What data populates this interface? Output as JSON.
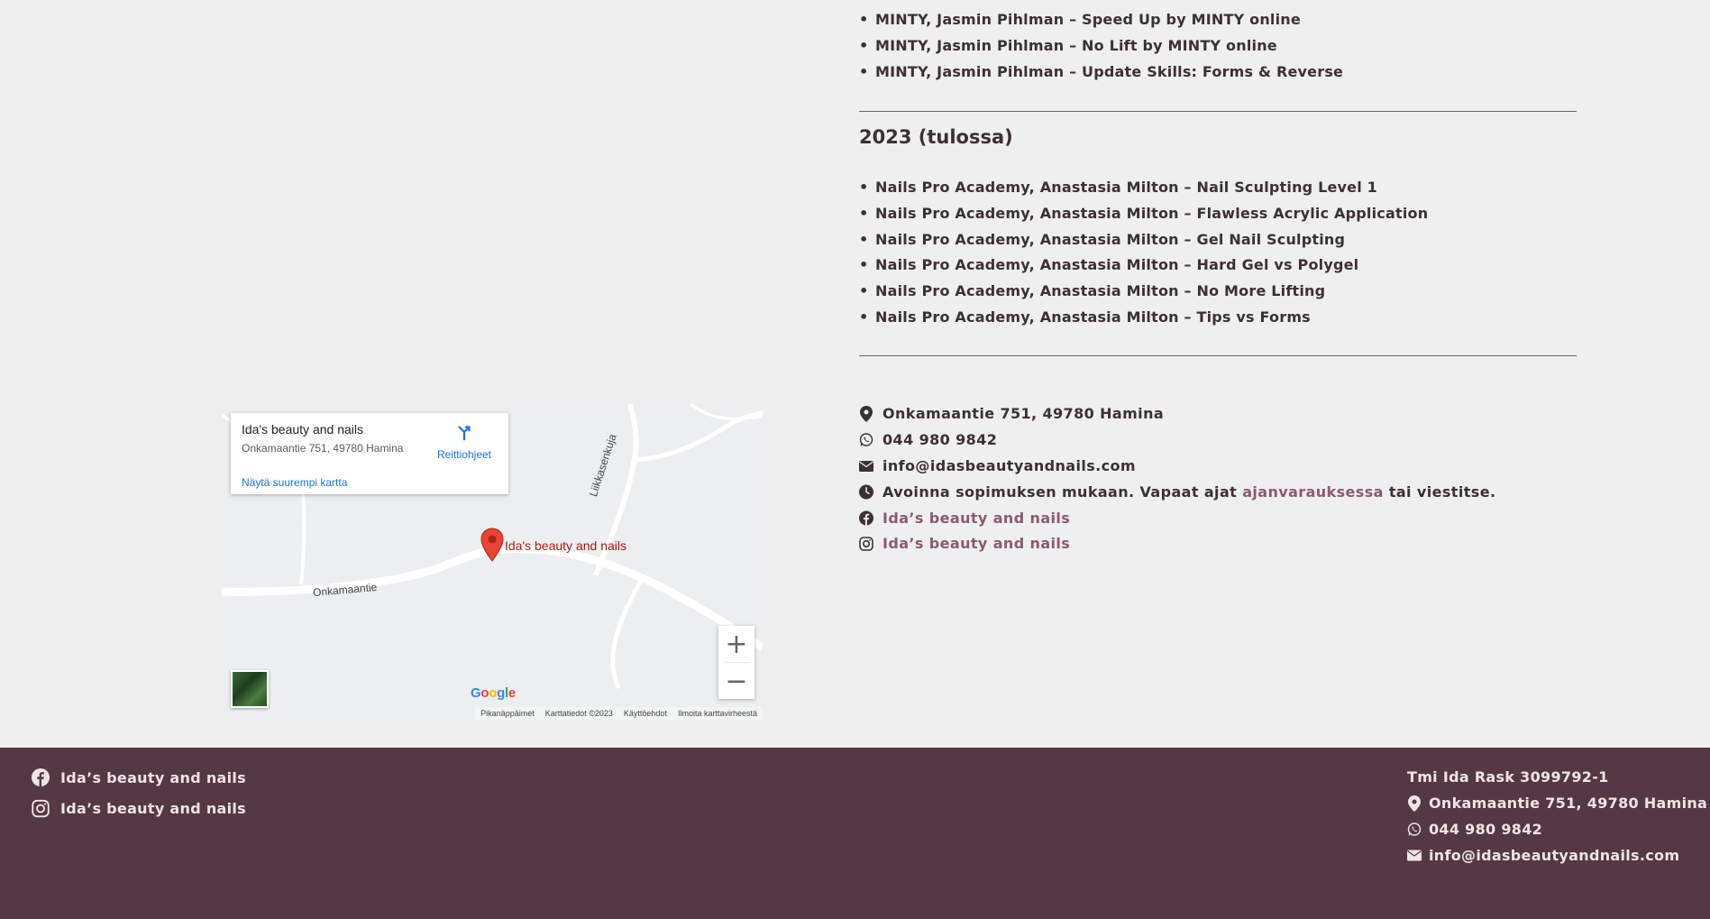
{
  "colors": {
    "page_bg": "#efefef",
    "text": "#3b3035",
    "link": "#8a5a70",
    "divider": "#7a5a66",
    "footer_bg": "#543843",
    "footer_text": "#f1e4e4"
  },
  "courses_2022": [
    "MINTY, Jasmin Pihlman – Speed Up by MINTY online",
    "MINTY, Jasmin Pihlman – No Lift by MINTY online",
    "MINTY, Jasmin Pihlman – Update Skills: Forms & Reverse"
  ],
  "year_2023": {
    "heading": "2023 (tulossa)",
    "courses": [
      "Nails Pro Academy, Anastasia Milton – Nail Sculpting Level 1",
      "Nails Pro Academy, Anastasia Milton – Flawless Acrylic Application",
      "Nails Pro Academy, Anastasia Milton – Gel Nail Sculpting",
      "Nails Pro Academy, Anastasia Milton – Hard Gel vs Polygel",
      "Nails Pro Academy, Anastasia Milton – No More Lifting",
      "Nails Pro Academy, Anastasia Milton – Tips vs Forms"
    ]
  },
  "contact": {
    "address": "Onkamaantie 751, 49780 Hamina",
    "phone": "044 980 9842",
    "email": "info@idasbeautyandnails.com",
    "hours_prefix": "Avoinna sopimuksen mukaan. Vapaat ajat",
    "hours_link": "ajanvarauksessa",
    "hours_suffix": "tai viestitse.",
    "facebook": "Ida’s beauty and nails",
    "instagram": "Ida’s beauty and nails"
  },
  "map": {
    "place_title": "Ida's beauty and nails",
    "place_address": "Onkamaantie 751, 49780 Hamina",
    "directions_label": "Reittiohjeet",
    "larger_map_label": "Näytä suurempi kartta",
    "marker_label": "Ida's beauty and nails",
    "street_1": "Onkamaantie",
    "street_2": "Liikkasenkuja",
    "zoom_in": "+",
    "zoom_out": "−",
    "logo": "Google",
    "footer": {
      "shortcuts": "Pikanäppäimet",
      "map_data": "Karttatiedot ©2023",
      "terms": "Käyttöehdot",
      "report": "Ilmoita karttavirheestä"
    }
  },
  "footer": {
    "facebook": "Ida’s beauty and nails",
    "instagram": "Ida’s beauty and nails",
    "company": "Tmi Ida Rask 3099792-1",
    "address": "Onkamaantie 751, 49780 Hamina",
    "phone": "044 980 9842",
    "email": "info@idasbeautyandnails.com"
  }
}
